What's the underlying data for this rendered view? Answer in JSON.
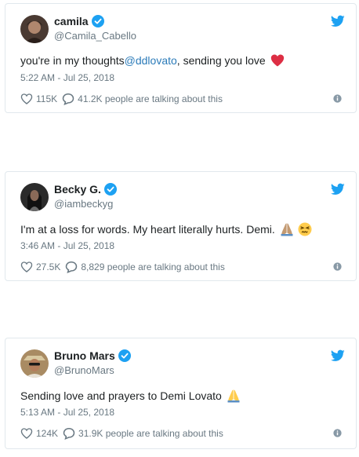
{
  "tweets": [
    {
      "name": "camila",
      "handle": "@Camila_Cabello",
      "text_before": "you're in my thoughts ",
      "mention": "@ddlovato",
      "text_after": ",  sending you love",
      "time": "5:22 AM - Jul 25, 2018",
      "likes": "115K",
      "talking": "41.2K people are talking about this",
      "emoji": [
        "red-heart"
      ]
    },
    {
      "name": "Becky G.",
      "handle": "@iambeckyg",
      "text_before": "I'm at a loss for words. My heart literally hurts. Demi.",
      "mention": "",
      "text_after": "",
      "time": "3:46 AM - Jul 25, 2018",
      "likes": "27.5K",
      "talking": "8,829 people are talking about this",
      "emoji": [
        "folded-hands",
        "persevering-face"
      ]
    },
    {
      "name": "Bruno Mars",
      "handle": "@BrunoMars",
      "text_before": "Sending love and prayers to Demi Lovato",
      "mention": "",
      "text_after": "",
      "time": "5:13 AM - Jul 25, 2018",
      "likes": "124K",
      "talking": "31.9K people are talking about this",
      "emoji": [
        "folded-hands"
      ]
    }
  ],
  "colors": {
    "verified": "#1da1f2",
    "twitter_bird": "#1da1f2",
    "link": "#2b7bb9",
    "muted": "#697882",
    "border": "#e1e8ed"
  }
}
